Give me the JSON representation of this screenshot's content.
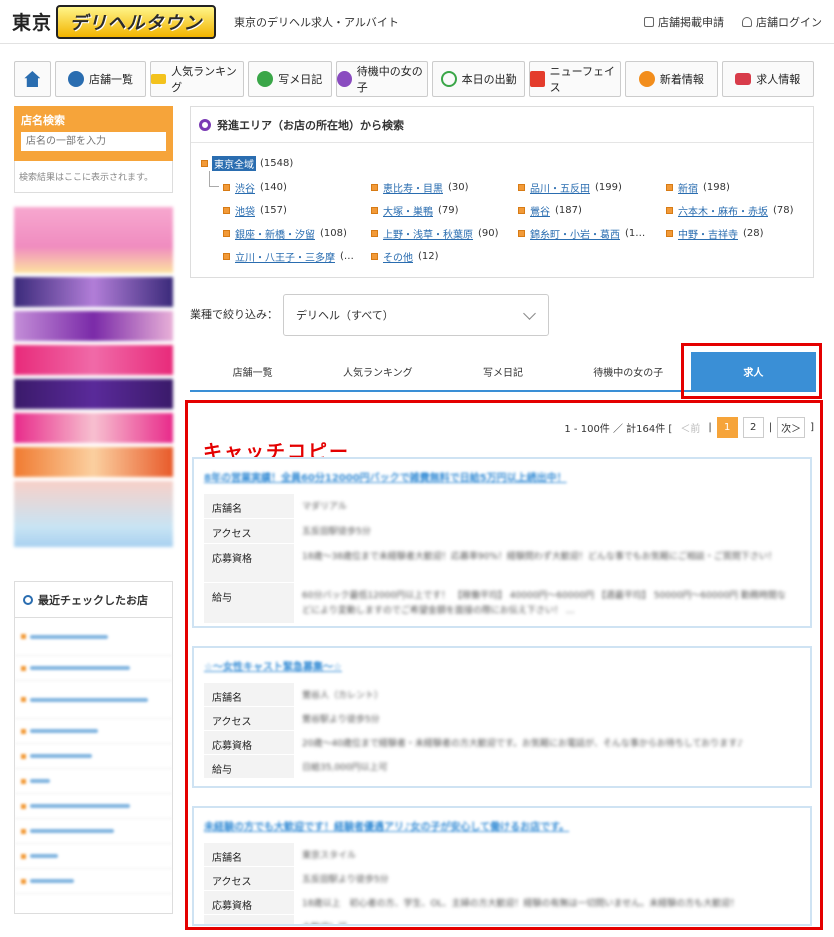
{
  "header": {
    "city": "東京",
    "logo_text": "デリヘルタウン",
    "tagline": "東京のデリヘル求人・アルバイト",
    "links": [
      "店舗掲載申請",
      "店舗ログイン"
    ]
  },
  "nav": [
    "店舗一覧",
    "人気ランキング",
    "写メ日記",
    "待機中の女の子",
    "本日の出勤",
    "ニューフェイス",
    "新着情報",
    "求人情報"
  ],
  "shop_search": {
    "title": "店名検索",
    "placeholder": "店名の一部を入力",
    "note": "検索結果はここに表示されます。"
  },
  "recent": {
    "title": "最近チェックしたお店"
  },
  "area": {
    "title": "発進エリア（お店の所在地）から検索",
    "all": {
      "name": "東京全域",
      "count": "(1548)"
    },
    "items": [
      {
        "name": "渋谷",
        "count": "(140)"
      },
      {
        "name": "恵比寿・目黒",
        "count": "(30)"
      },
      {
        "name": "品川・五反田",
        "count": "(199)"
      },
      {
        "name": "新宿",
        "count": "(198)"
      },
      {
        "name": "池袋",
        "count": "(157)"
      },
      {
        "name": "大塚・巣鴨",
        "count": "(79)"
      },
      {
        "name": "鶯谷",
        "count": "(187)"
      },
      {
        "name": "六本木・麻布・赤坂",
        "count": "(78)"
      },
      {
        "name": "銀座・新橋・汐留",
        "count": "(108)"
      },
      {
        "name": "上野・浅草・秋葉原",
        "count": "(90)"
      },
      {
        "name": "錦糸町・小岩・葛西",
        "count": "(1…"
      },
      {
        "name": "中野・吉祥寺",
        "count": "(28)"
      },
      {
        "name": "立川・八王子・三多摩",
        "count": "(…"
      },
      {
        "name": "その他",
        "count": "(12)"
      }
    ]
  },
  "filter": {
    "label": "業種で絞り込み：",
    "value": "デリヘル（すべて）"
  },
  "tabs": [
    "店舗一覧",
    "人気ランキング",
    "写メ日記",
    "待機中の女の子",
    "求人"
  ],
  "annotation": "キャッチコピー",
  "pager": {
    "range": "1 - 100件 ／ 計164件 [",
    "prev": "＜前",
    "pages": [
      "1",
      "2"
    ],
    "next": "次＞",
    "close": "]"
  },
  "field_labels": [
    "店舗名",
    "アクセス",
    "応募資格",
    "給与"
  ],
  "listings": [
    {
      "title": "8年の営業実績！全員60分12000円バックで雑費無料で日給5万円以上続出中！",
      "values": [
        "マダリアル",
        "五反田駅徒歩5分",
        "18歳～38歳位まで未経験者大歓迎！応募率90%！経験問わず大歓迎！どんな事でもお気軽にご相談・ご質問下さい！",
        "60分バック最低12000円以上です！ 【稼働平均】 40000円～60000円 【週最平均】 50000円～60000円 勤務時間などにより変動しますのでご希望金額を面接の際にお伝え下さい！ …"
      ]
    },
    {
      "title": "☆～女性キャスト緊急募集～☆",
      "values": [
        "鶯谷人（カレント）",
        "鶯谷駅より徒歩5分",
        "20歳～40歳位まで経験者・未経験者の方大歓迎です。お気軽にお電話が、そんな事からお待ちしております♪",
        "日給35,000円以上可"
      ]
    },
    {
      "title": "未経験の方でも大歓迎です！経験者優遇アリ♪女の子が安心して働けるお店です。",
      "values": [
        "東京スタイル",
        "五反田駅より徒歩5分",
        "18歳以上　初心者の方、学生、OL、主婦の方大歓迎！経験の有無は一切問いません。未経験の方も大歓迎！",
        "大歓迎！可"
      ]
    }
  ],
  "colors": {
    "accent": "#3a8fd6",
    "orange": "#f6a43a",
    "highlight": "#e40000"
  }
}
